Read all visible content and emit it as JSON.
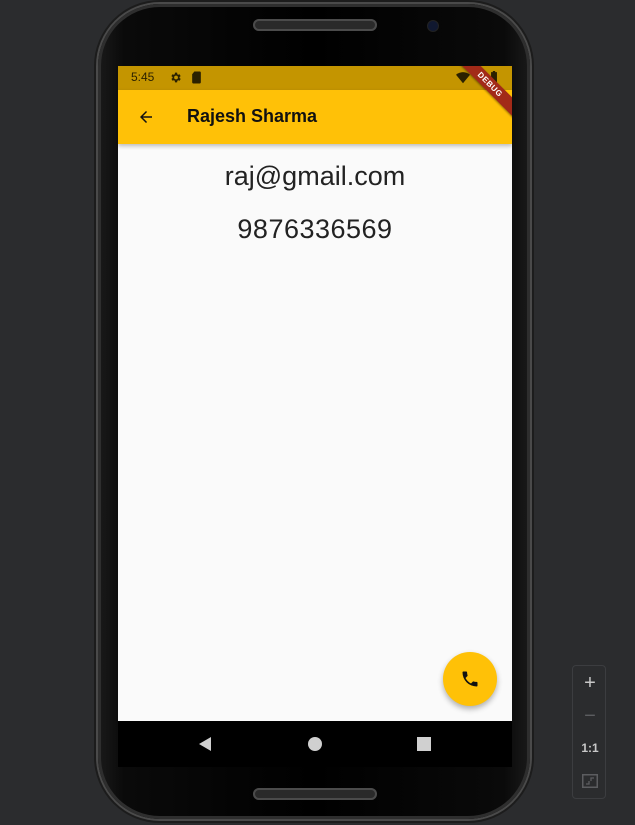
{
  "status_bar": {
    "time": "5:45",
    "icons": [
      "gear-icon",
      "sd-card-icon",
      "wifi-icon",
      "battery-icon"
    ],
    "color": "#c49500"
  },
  "app_bar": {
    "title": "Rajesh Sharma",
    "back_icon": "arrow-back-icon",
    "color": "#ffc107"
  },
  "debug_banner": "DEBUG",
  "contact": {
    "email": "raj@gmail.com",
    "phone": "9876336569"
  },
  "fab": {
    "icon": "phone-icon",
    "color": "#ffc107"
  },
  "navigation": {
    "buttons": [
      "back-triangle-icon",
      "home-circle-icon",
      "recents-square-icon"
    ]
  },
  "zoom_controls": {
    "zoom_in": "+",
    "zoom_out": "−",
    "actual_size": "1:1",
    "fit_icon": "fit-screen-icon"
  }
}
